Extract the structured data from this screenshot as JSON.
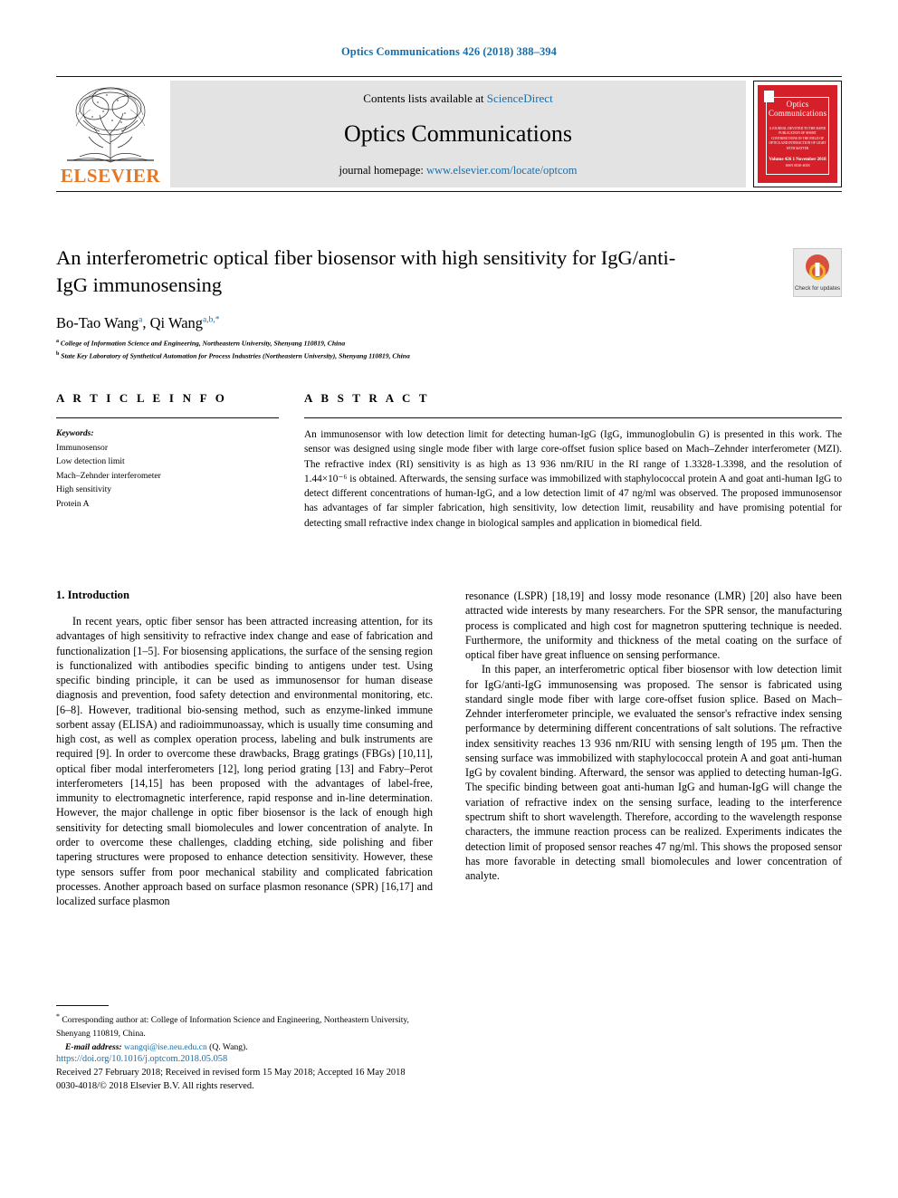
{
  "running_head": "Optics Communications 426 (2018) 388–394",
  "masthead": {
    "contents_prefix": "Contents lists available at ",
    "contents_link": "ScienceDirect",
    "journal_title": "Optics Communications",
    "homepage_prefix": "journal homepage: ",
    "homepage_link": "www.elsevier.com/locate/optcom",
    "publisher": "ELSEVIER",
    "cover": {
      "title": "Optics Communications",
      "subtitle": "A JOURNAL DEVOTED TO THE RAPID PUBLICATION OF SHORT CONTRIBUTIONS IN THE FIELD OF OPTICS AND INTERACTION OF LIGHT WITH MATTER",
      "volume": "Volume 426   1 November 2018",
      "issn": "ISSN 0030-4018"
    }
  },
  "article": {
    "title": "An interferometric optical fiber biosensor with high sensitivity for IgG/anti-IgG immunosensing",
    "authors": "Bo-Tao Wang",
    "author1_sup": "a",
    "authors_sep": ", ",
    "author2": "Qi Wang",
    "author2_sup": "a,b,*",
    "affiliation_a_sup": "a",
    "affiliation_a": "College of Information Science and Engineering, Northeastern University, Shenyang 110819, China",
    "affiliation_b_sup": "b",
    "affiliation_b": "State Key Laboratory of Synthetical Automation for Process Industries (Northeastern University), Shenyang 110819, China",
    "crossmark_label": "Check for updates"
  },
  "info": {
    "heading": "A R T I C L E   I N F O",
    "keywords_label": "Keywords:",
    "keywords": [
      "Immunosensor",
      "Low detection limit",
      "Mach–Zehnder interferometer",
      "High sensitivity",
      "Protein A"
    ]
  },
  "abstract": {
    "heading": "A B S T R A C T",
    "text": "An immunosensor with low detection limit for detecting human-IgG (IgG, immunoglobulin G) is presented in this work. The sensor was designed using single mode fiber with large core-offset fusion splice based on Mach–Zehnder interferometer (MZI). The refractive index (RI) sensitivity is as high as 13 936 nm/RIU in the RI range of 1.3328-1.3398, and the resolution of 1.44×10⁻⁶ is obtained. Afterwards, the sensing surface was immobilized with staphylococcal protein A and goat anti-human IgG to detect different concentrations of human-IgG, and a low detection limit of 47 ng/ml was observed. The proposed immunosensor has advantages of far simpler fabrication, high sensitivity, low detection limit, reusability and have promising potential for detecting small refractive index change in biological samples and application in biomedical field."
  },
  "body": {
    "section_title": "1. Introduction",
    "left_paragraphs": [
      "In recent years, optic fiber sensor has been attracted increasing attention, for its advantages of high sensitivity to refractive index change and ease of fabrication and functionalization [1–5]. For biosensing applications, the surface of the sensing region is functionalized with antibodies specific binding to antigens under test. Using specific binding principle, it can be used as immunosensor for human disease diagnosis and prevention, food safety detection and environmental monitoring, etc. [6–8]. However, traditional bio-sensing method, such as enzyme-linked immune sorbent assay (ELISA) and radioimmunoassay, which is usually time consuming and high cost, as well as complex operation process, labeling and bulk instruments are required [9]. In order to overcome these drawbacks, Bragg gratings (FBGs) [10,11], optical fiber modal interferometers [12], long period grating [13] and Fabry–Perot interferometers [14,15] has been proposed with the advantages of label-free, immunity to electromagnetic interference, rapid response and in-line determination. However, the major challenge in optic fiber biosensor is the lack of enough high sensitivity for detecting small biomolecules and lower concentration of analyte. In order to overcome these challenges, cladding etching, side polishing and fiber tapering structures were proposed to enhance detection sensitivity. However, these type sensors suffer from poor mechanical stability and complicated fabrication processes. Another approach based on surface plasmon resonance (SPR) [16,17] and localized surface plasmon"
    ],
    "right_paragraphs": [
      "resonance (LSPR) [18,19] and lossy mode resonance (LMR) [20] also have been attracted wide interests by many researchers. For the SPR sensor, the manufacturing process is complicated and high cost for magnetron sputtering technique is needed. Furthermore, the uniformity and thickness of the metal coating on the surface of optical fiber have great influence on sensing performance.",
      "In this paper, an interferometric optical fiber biosensor with low detection limit for IgG/anti-IgG immunosensing was proposed. The sensor is fabricated using standard single mode fiber with large core-offset fusion splice. Based on Mach–Zehnder interferometer principle, we evaluated the sensor's refractive index sensing performance by determining different concentrations of salt solutions. The refractive index sensitivity reaches 13 936 nm/RIU with sensing length of 195 μm. Then the sensing surface was immobilized with staphylococcal protein A and goat anti-human IgG by covalent binding. Afterward, the sensor was applied to detecting human-IgG. The specific binding between goat anti-human IgG and human-IgG will change the variation of refractive index on the sensing surface, leading to the interference spectrum shift to short wavelength. Therefore, according to the wavelength response characters, the immune reaction process can be realized. Experiments indicates the detection limit of proposed sensor reaches 47 ng/ml. This shows the proposed sensor has more favorable in detecting small biomolecules and lower concentration of analyte."
    ]
  },
  "footer": {
    "corresponding_marker": "*",
    "corresponding_text": "Corresponding author at: College of Information Science and Engineering, Northeastern University, Shenyang 110819, China.",
    "email_label": "E-mail address:",
    "email": "wangqi@ise.neu.edu.cn",
    "email_suffix": "(Q. Wang).",
    "doi": "https://doi.org/10.1016/j.optcom.2018.05.058",
    "dates": "Received 27 February 2018; Received in revised form 15 May 2018; Accepted 16 May 2018",
    "copyright": "0030-4018/© 2018 Elsevier B.V. All rights reserved."
  },
  "colors": {
    "link": "#1a6ea8",
    "elsevier_orange": "#e87722",
    "cover_red": "#d5202a"
  }
}
